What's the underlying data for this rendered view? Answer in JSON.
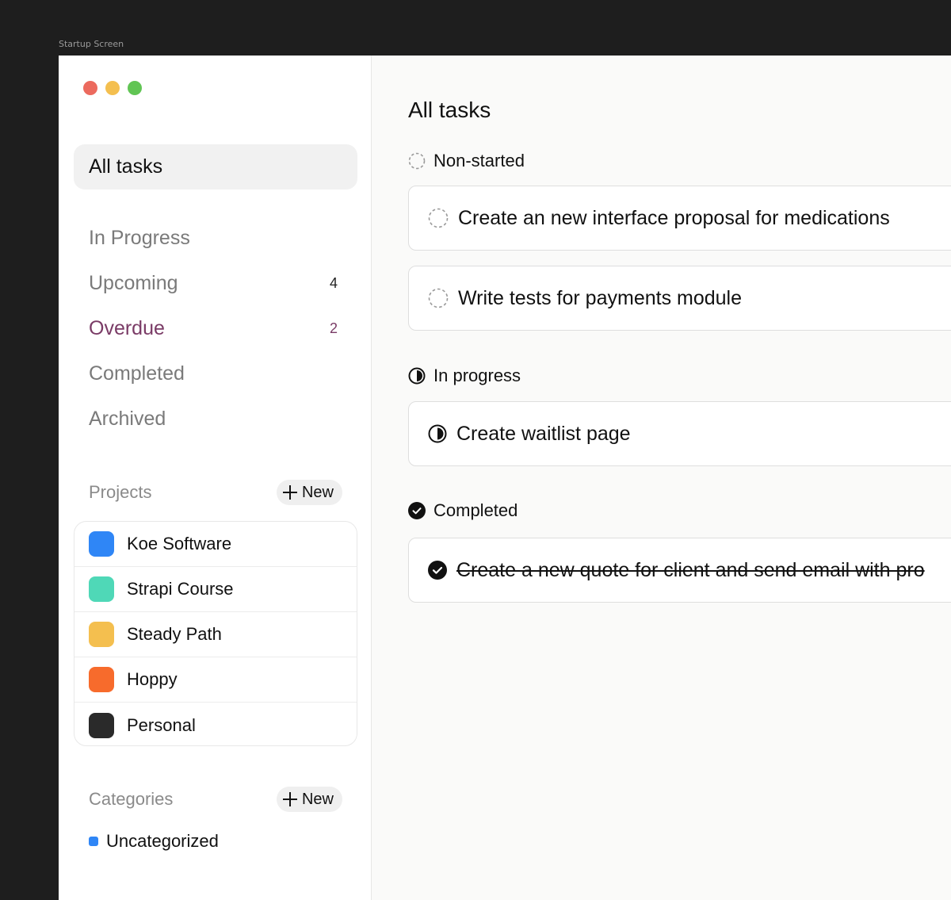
{
  "frame_label": "Startup Screen",
  "sidebar": {
    "active_item": "All tasks",
    "nav": [
      {
        "label": "In Progress",
        "count": ""
      },
      {
        "label": "Upcoming",
        "count": "4"
      },
      {
        "label": "Overdue",
        "count": "2"
      },
      {
        "label": "Completed",
        "count": ""
      },
      {
        "label": "Archived",
        "count": ""
      }
    ],
    "projects": {
      "title": "Projects",
      "new_label": "New",
      "items": [
        {
          "label": "Koe Software",
          "color": "#2f86f6"
        },
        {
          "label": "Strapi Course",
          "color": "#4fd8b7"
        },
        {
          "label": "Steady Path",
          "color": "#f4bf4f"
        },
        {
          "label": "Hoppy",
          "color": "#f76b2c"
        },
        {
          "label": "Personal",
          "color": "#2a2a2a"
        }
      ]
    },
    "categories": {
      "title": "Categories",
      "new_label": "New",
      "items": [
        {
          "label": "Uncategorized",
          "color": "#2f86f6"
        }
      ]
    }
  },
  "main": {
    "title": "All tasks",
    "groups": [
      {
        "label": "Non-started",
        "icon": "dashed-circle-icon",
        "tasks": [
          "Create an new interface proposal for medications",
          "Write tests for payments module"
        ]
      },
      {
        "label": "In progress",
        "icon": "half-circle-icon",
        "tasks": [
          "Create waitlist page"
        ]
      },
      {
        "label": "Completed",
        "icon": "check-circle-icon",
        "tasks": [
          "Create a new quote for client and send email with pro"
        ]
      }
    ]
  }
}
